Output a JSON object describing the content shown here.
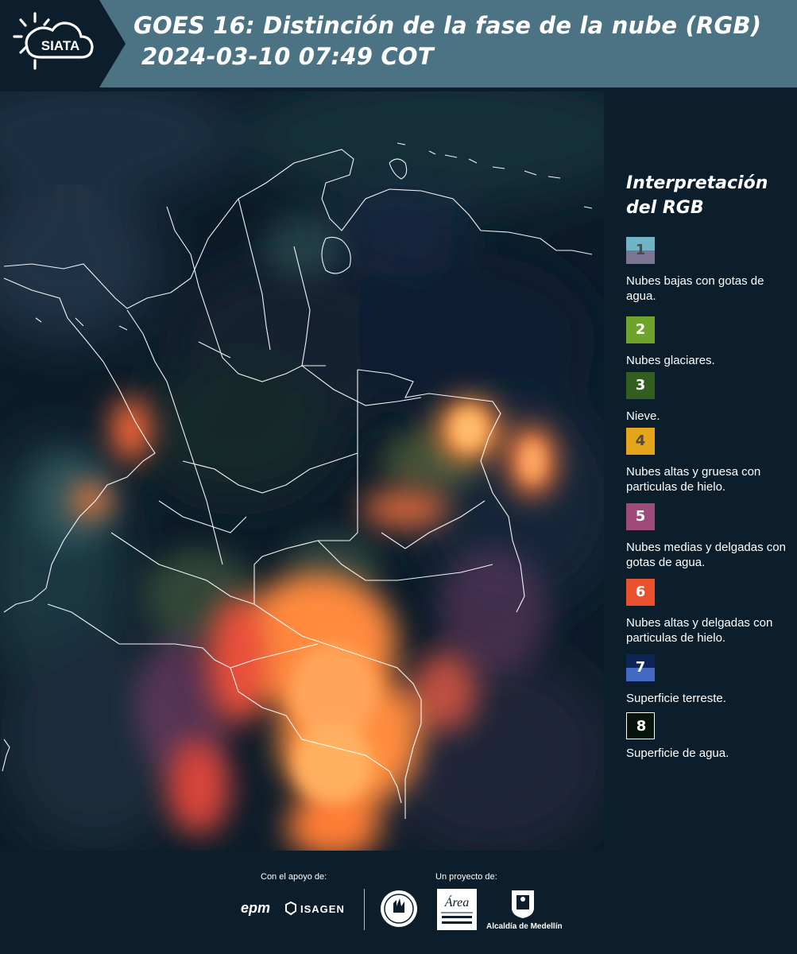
{
  "header": {
    "logo_text": "SIATA",
    "title_line1": "GOES 16: Distinción de la fase de la nube (RGB)",
    "title_line2": "2024-03-10 07:49 COT"
  },
  "legend": {
    "title_line1": "Interpretación",
    "title_line2": "del RGB",
    "items": [
      {
        "number": "1",
        "label": "Nubes bajas con gotas de agua.",
        "color_top": "#6fb5c6",
        "color_bottom": "#7a7592",
        "num_color": "#4b4b4b"
      },
      {
        "number": "2",
        "label": "Nubes glaciares.",
        "color_top": "#6ea32e",
        "color_bottom": "#6ea32e",
        "num_color": "#ffffff"
      },
      {
        "number": "3",
        "label": "Nieve.",
        "color_top": "#325e1f",
        "color_bottom": "#325e1f",
        "num_color": "#ffffff"
      },
      {
        "number": "4",
        "label": "Nubes altas y gruesa con particulas de hielo.",
        "color_top": "#e5a51b",
        "color_bottom": "#e5a51b",
        "num_color": "#4b4b4b"
      },
      {
        "number": "5",
        "label": "Nubes medias y delgadas con gotas de agua.",
        "color_top": "#9e4b7c",
        "color_bottom": "#9e4b7c",
        "num_color": "#ffffff"
      },
      {
        "number": "6",
        "label": "Nubes altas y delgadas con particulas de hielo.",
        "color_top": "#e9512e",
        "color_bottom": "#e9512e",
        "num_color": "#ffffff"
      },
      {
        "number": "7",
        "label": "Superficie terreste.",
        "color_top": "#0e2558",
        "color_bottom": "#4469c3",
        "num_color": "#ffffff"
      },
      {
        "number": "8",
        "label": "Superficie de agua.",
        "color_top": "#07140c",
        "color_bottom": "#07140c",
        "num_color": "#ffffff"
      }
    ]
  },
  "footer": {
    "support_label": "Con el apoyo de:",
    "project_label": "Un proyecto de:",
    "sponsors": [
      "epm",
      "ISAGEN"
    ],
    "partners": [
      "Área Metropolitana Valle de Aburrá",
      "Alcaldía de Medellín"
    ]
  },
  "colors": {
    "header_bg": "#4b7383",
    "page_bg": "#0c1e2b",
    "boundary": "#ffffff"
  }
}
